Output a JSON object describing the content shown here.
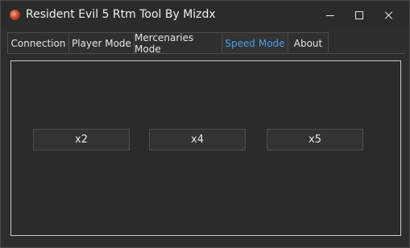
{
  "window": {
    "title": "Resident Evil 5 Rtm Tool By Mizdx",
    "icon": "app-logo-icon",
    "controls": {
      "minimize": "minimize-icon",
      "maximize": "maximize-icon",
      "close": "close-icon"
    }
  },
  "tabs": [
    {
      "label": "Connection"
    },
    {
      "label": "Player Mode"
    },
    {
      "label": "Mercenaries Mode"
    },
    {
      "label": "Speed Mode",
      "active": true
    },
    {
      "label": "About"
    }
  ],
  "speed_mode": {
    "buttons": [
      {
        "label": "x2"
      },
      {
        "label": "x4"
      },
      {
        "label": "x5"
      }
    ]
  },
  "colors": {
    "background": "#2b2b2b",
    "active_tab_text": "#4a9fe8",
    "panel_border": "#c8c8c8"
  }
}
